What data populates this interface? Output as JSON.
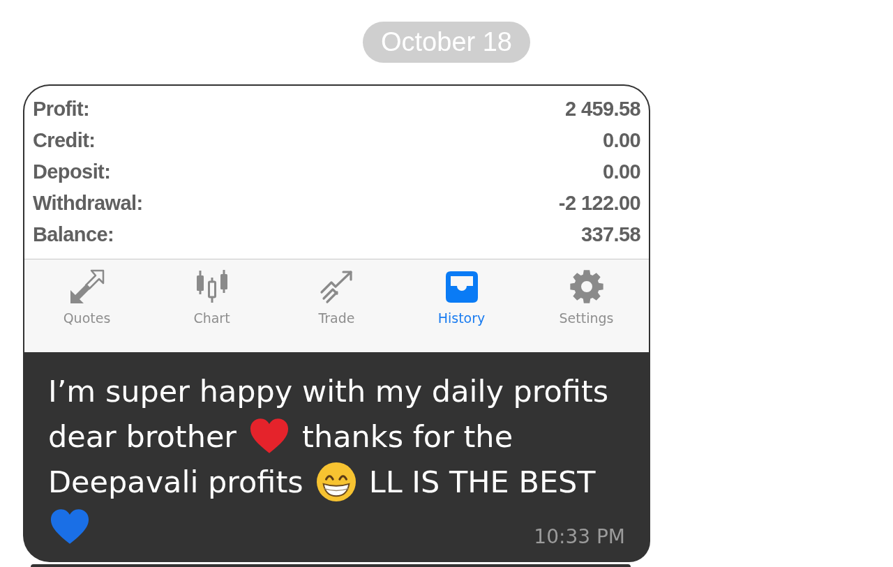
{
  "date_divider": {
    "label": "October 18"
  },
  "message": {
    "attachment": {
      "summary": [
        {
          "label": "Profit:",
          "value": "2 459.58"
        },
        {
          "label": "Credit:",
          "value": "0.00"
        },
        {
          "label": "Deposit:",
          "value": "0.00"
        },
        {
          "label": "Withdrawal:",
          "value": "-2 122.00"
        },
        {
          "label": "Balance:",
          "value": "337.58"
        }
      ],
      "tabs": [
        {
          "label": "Quotes",
          "selected": false
        },
        {
          "label": "Chart",
          "selected": false
        },
        {
          "label": "Trade",
          "selected": false
        },
        {
          "label": "History",
          "selected": true
        },
        {
          "label": "Settings",
          "selected": false
        }
      ]
    },
    "lines": [
      {
        "segments": [
          {
            "kind": "text",
            "text": "I’m super happy with my daily profits"
          }
        ]
      },
      {
        "segments": [
          {
            "kind": "text",
            "text": "dear brother"
          },
          {
            "kind": "heart",
            "color": "#e5232b"
          },
          {
            "kind": "text",
            "text": "thanks for the"
          }
        ]
      },
      {
        "segments": [
          {
            "kind": "text",
            "text": "Deepavali profits"
          },
          {
            "kind": "grin"
          },
          {
            "kind": "text",
            "text": "LL IS THE BEST"
          }
        ]
      },
      {
        "segments": [
          {
            "kind": "heart",
            "color": "#1a6fe6"
          }
        ]
      }
    ],
    "time": "10:33 PM"
  }
}
